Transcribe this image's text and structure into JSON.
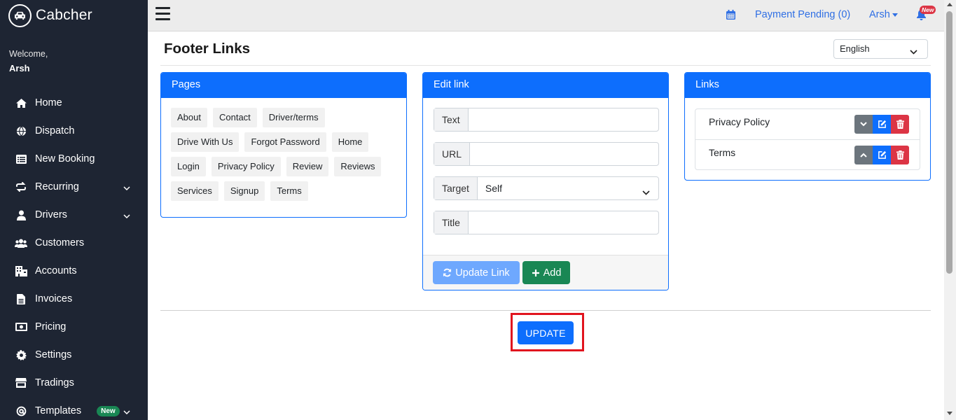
{
  "app": {
    "brand": "Cabcher"
  },
  "sidebar": {
    "welcome": "Welcome,",
    "user": "Arsh",
    "items": [
      {
        "label": "Home",
        "icon": "home-icon"
      },
      {
        "label": "Dispatch",
        "icon": "globe-icon"
      },
      {
        "label": "New Booking",
        "icon": "list-icon"
      },
      {
        "label": "Recurring",
        "icon": "repeat-icon",
        "expandable": true
      },
      {
        "label": "Drivers",
        "icon": "user-icon",
        "expandable": true
      },
      {
        "label": "Customers",
        "icon": "users-icon"
      },
      {
        "label": "Accounts",
        "icon": "building-icon"
      },
      {
        "label": "Invoices",
        "icon": "file-icon"
      },
      {
        "label": "Pricing",
        "icon": "money-icon"
      },
      {
        "label": "Settings",
        "icon": "gear-icon"
      },
      {
        "label": "Tradings",
        "icon": "store-icon"
      },
      {
        "label": "Templates",
        "icon": "at-icon",
        "badge": "New",
        "expandable": true
      }
    ]
  },
  "topbar": {
    "payment_pending": "Payment Pending (0)",
    "user": "Arsh",
    "notif_badge": "New"
  },
  "page": {
    "title": "Footer Links",
    "language": "English"
  },
  "pages_card": {
    "title": "Pages",
    "tags": [
      "About",
      "Contact",
      "Driver/terms",
      "Drive With Us",
      "Forgot Password",
      "Home",
      "Login",
      "Privacy Policy",
      "Review",
      "Reviews",
      "Services",
      "Signup",
      "Terms"
    ]
  },
  "edit_card": {
    "title": "Edit link",
    "fields": {
      "text_label": "Text",
      "text_value": "",
      "url_label": "URL",
      "url_value": "",
      "target_label": "Target",
      "target_value": "Self",
      "title_label": "Title",
      "title_value": ""
    },
    "update_link_label": "Update Link",
    "add_label": "Add"
  },
  "links_card": {
    "title": "Links",
    "items": [
      {
        "label": "Privacy Policy"
      },
      {
        "label": "Terms"
      }
    ]
  },
  "update_button": "UPDATE",
  "colors": {
    "sidebar_bg": "#1e2533",
    "primary": "#0d6efd",
    "success": "#198754",
    "danger": "#dc3545",
    "secondary": "#6c757d",
    "highlight": "#e1141e"
  }
}
